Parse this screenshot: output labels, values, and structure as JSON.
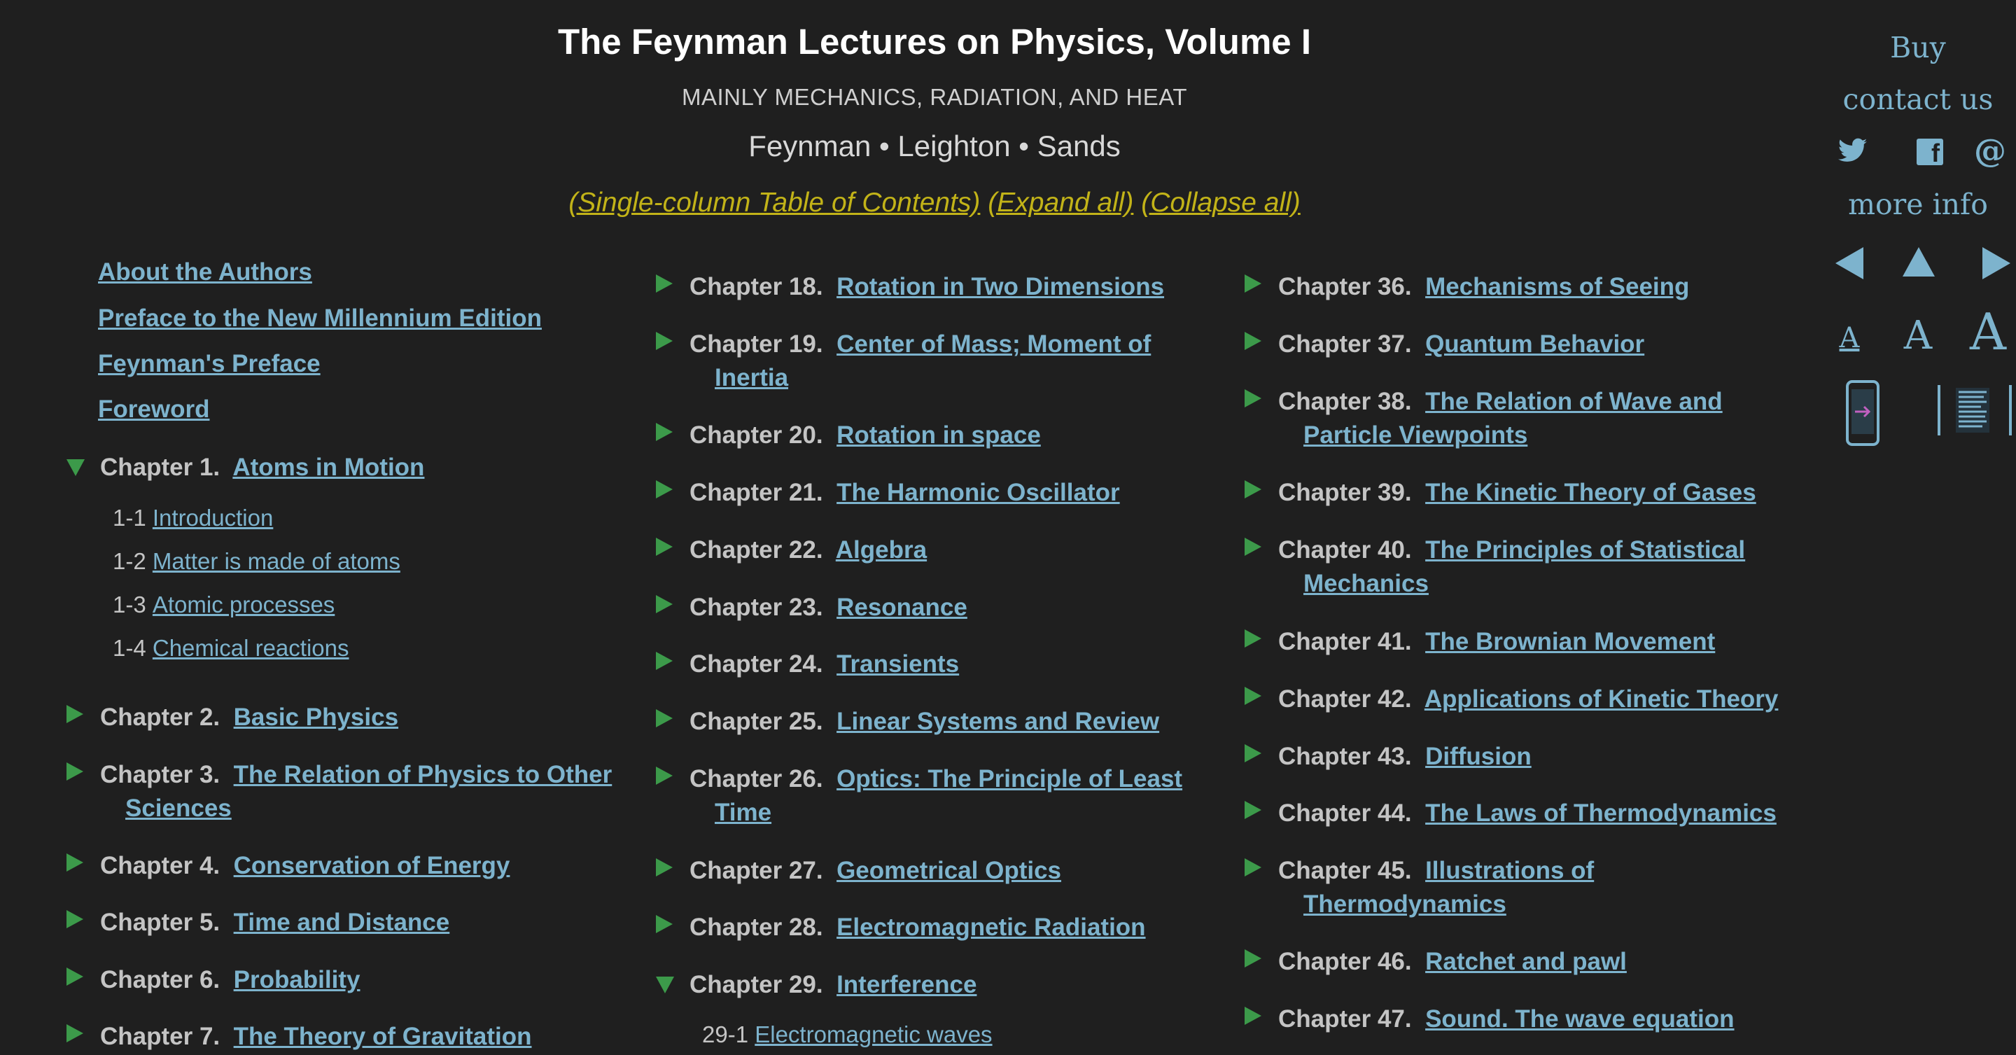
{
  "header": {
    "title": "The Feynman Lectures on Physics, Volume I",
    "subtitle": "MAINLY MECHANICS, RADIATION, AND HEAT",
    "authors": "Feynman • Leighton • Sands",
    "toc_links": [
      "(Single-column Table of Contents)",
      "(Expand all)",
      "(Collapse all)"
    ]
  },
  "front_matter": [
    "About the Authors",
    "Preface to the New Millennium Edition",
    "Feynman's Preface",
    "Foreword"
  ],
  "chapter1": {
    "num": "Chapter 1.",
    "title": "Atoms in Motion",
    "sections": [
      {
        "num": "1-1",
        "title": "Introduction"
      },
      {
        "num": "1-2",
        "title": "Matter is made of atoms"
      },
      {
        "num": "1-3",
        "title": "Atomic processes"
      },
      {
        "num": "1-4",
        "title": "Chemical reactions"
      }
    ]
  },
  "col1": [
    {
      "num": "Chapter 2.",
      "title1": "Basic Physics",
      "title2": ""
    },
    {
      "num": "Chapter 3.",
      "title1": "The Relation of Physics to Other",
      "title2": "Sciences"
    },
    {
      "num": "Chapter 4.",
      "title1": "Conservation of Energy",
      "title2": ""
    },
    {
      "num": "Chapter 5.",
      "title1": "Time and Distance",
      "title2": ""
    },
    {
      "num": "Chapter 6.",
      "title1": "Probability",
      "title2": ""
    },
    {
      "num": "Chapter 7.",
      "title1": "The Theory of Gravitation",
      "title2": ""
    }
  ],
  "col2": [
    {
      "num": "Chapter 18.",
      "title1": "Rotation in Two Dimensions",
      "title2": ""
    },
    {
      "num": "Chapter 19.",
      "title1": "Center of Mass; Moment of",
      "title2": "Inertia"
    },
    {
      "num": "Chapter 20.",
      "title1": "Rotation in space",
      "title2": ""
    },
    {
      "num": "Chapter 21.",
      "title1": "The Harmonic Oscillator",
      "title2": ""
    },
    {
      "num": "Chapter 22.",
      "title1": "Algebra",
      "title2": ""
    },
    {
      "num": "Chapter 23.",
      "title1": "Resonance",
      "title2": ""
    },
    {
      "num": "Chapter 24.",
      "title1": "Transients",
      "title2": ""
    },
    {
      "num": "Chapter 25.",
      "title1": "Linear Systems and Review",
      "title2": ""
    },
    {
      "num": "Chapter 26.",
      "title1": "Optics: The Principle of Least",
      "title2": "Time"
    },
    {
      "num": "Chapter 27.",
      "title1": "Geometrical Optics",
      "title2": ""
    },
    {
      "num": "Chapter 28.",
      "title1": "Electromagnetic Radiation",
      "title2": ""
    },
    {
      "num": "Chapter 29.",
      "title1": "Interference",
      "title2": ""
    }
  ],
  "chapter29_sections": [
    {
      "num": "29-1",
      "title": "Electromagnetic waves"
    }
  ],
  "col3": [
    {
      "num": "Chapter 36.",
      "title1": "Mechanisms of Seeing",
      "title2": ""
    },
    {
      "num": "Chapter 37.",
      "title1": "Quantum Behavior",
      "title2": ""
    },
    {
      "num": "Chapter 38.",
      "title1": "The Relation of Wave and",
      "title2": "Particle Viewpoints"
    },
    {
      "num": "Chapter 39.",
      "title1": "The Kinetic Theory of Gases",
      "title2": ""
    },
    {
      "num": "Chapter 40.",
      "title1": "The Principles of Statistical",
      "title2": "Mechanics"
    },
    {
      "num": "Chapter 41.",
      "title1": "The Brownian Movement",
      "title2": ""
    },
    {
      "num": "Chapter 42.",
      "title1": "Applications of Kinetic Theory",
      "title2": ""
    },
    {
      "num": "Chapter 43.",
      "title1": "Diffusion",
      "title2": ""
    },
    {
      "num": "Chapter 44.",
      "title1": "The Laws of Thermodynamics",
      "title2": ""
    },
    {
      "num": "Chapter 45.",
      "title1": "Illustrations of",
      "title2": "Thermodynamics"
    },
    {
      "num": "Chapter 46.",
      "title1": "Ratchet and pawl",
      "title2": ""
    },
    {
      "num": "Chapter 47.",
      "title1": "Sound. The wave equation",
      "title2": ""
    }
  ],
  "sidebar": {
    "buy": "Buy",
    "contact": "contact us",
    "more_info": "more info",
    "social_icons": [
      "twitter-icon",
      "facebook-icon",
      "email-icon"
    ],
    "facebook_glyph": "f",
    "email_glyph": "@",
    "font_sizes": [
      "A",
      "A",
      "A"
    ]
  },
  "colors": {
    "background": "#1f1f1f",
    "link": "#7db3cd",
    "toc_links": "#c2b318",
    "triangle": "#3c9a4a"
  }
}
